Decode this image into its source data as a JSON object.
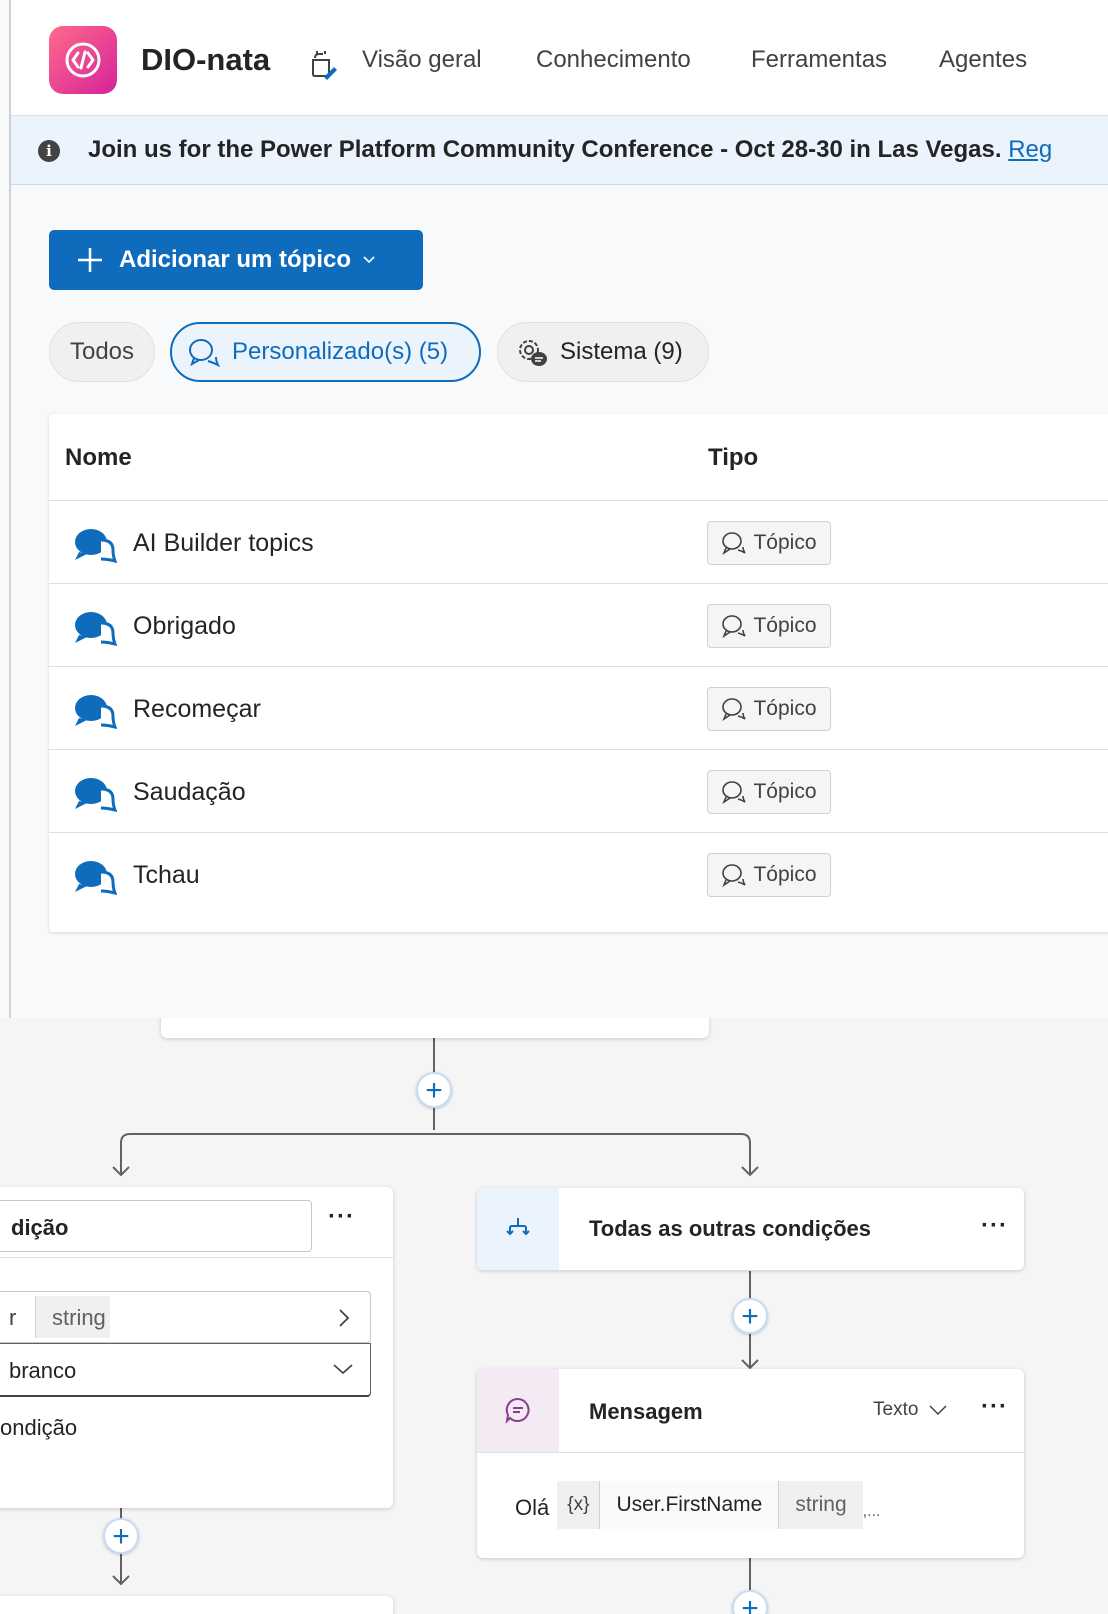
{
  "header": {
    "app_name": "DIO-nata",
    "nav": [
      "Visão geral",
      "Conhecimento",
      "Ferramentas",
      "Agentes"
    ]
  },
  "banner": {
    "text": "Join us for the Power Platform Community Conference - Oct 28-30 in Las Vegas.",
    "link": "Reg"
  },
  "add_topic_button": "Adicionar um tópico",
  "filters": {
    "all": "Todos",
    "custom": "Personalizado(s) (5)",
    "system": "Sistema (9)"
  },
  "table": {
    "columns": [
      "Nome",
      "Tipo"
    ],
    "rows": [
      {
        "name": "AI Builder topics",
        "type": "Tópico"
      },
      {
        "name": "Obrigado",
        "type": "Tópico"
      },
      {
        "name": "Recomeçar",
        "type": "Tópico"
      },
      {
        "name": "Saudação",
        "type": "Tópico"
      },
      {
        "name": "Tchau",
        "type": "Tópico"
      }
    ]
  },
  "canvas": {
    "condition_card": {
      "title": "dição",
      "var_prefix": "r",
      "var_type": "string",
      "operator": "branco",
      "add_condition": "ondição"
    },
    "other_conditions_card": {
      "title": "Todas as outras condições"
    },
    "message_card": {
      "title": "Mensagem",
      "format": "Texto",
      "greeting": "Olá",
      "var_token": "{x}",
      "var_name": "User.FirstName",
      "var_type": "string",
      "trailing": ",..."
    },
    "more_menu": "···"
  },
  "colors": {
    "accent": "#0f6cbd",
    "logo_gradient_start": "#ff6a8a",
    "logo_gradient_end": "#d6229a"
  }
}
